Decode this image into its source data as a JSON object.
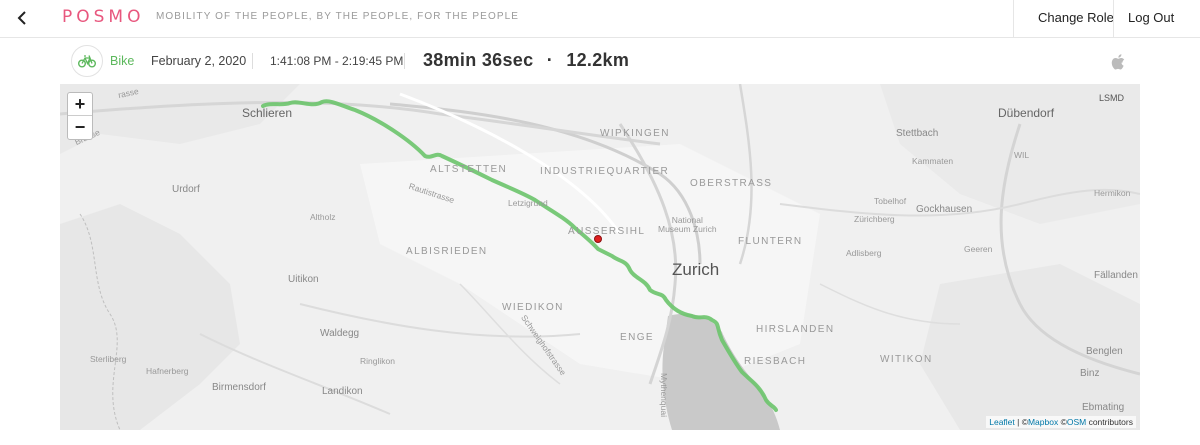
{
  "header": {
    "logo": "POSMO",
    "tagline": "MOBILITY OF THE PEOPLE, BY THE PEOPLE, FOR THE PEOPLE",
    "change_role": "Change Role",
    "log_out": "Log Out",
    "back_icon": "chevron-left-icon",
    "brand_color": "#e8577e"
  },
  "trip": {
    "mode_icon": "bicycle-icon",
    "mode": "Bike",
    "mode_color": "#5cb85c",
    "date": "February 2, 2020",
    "time_range": "1:41:08 PM - 2:19:45 PM",
    "duration": "38min 36sec",
    "separator": "·",
    "distance": "12.2km",
    "device_icon": "apple-icon"
  },
  "map": {
    "zoom_in": "+",
    "zoom_out": "−",
    "route_color": "#6cc46c",
    "marker_color": "#e02020",
    "attribution": {
      "leaflet": "Leaflet",
      "sep": " | ©",
      "mapbox": "Mapbox",
      "sep2": " ©",
      "osm": "OSM",
      "contributors": " contributors"
    },
    "labels": {
      "schlieren": "Schlieren",
      "dubendorf": "Dübendorf",
      "zurich": "Zurich",
      "wipkingen": "WIPKINGEN",
      "industriequartier": "INDUSTRIEQUARTIER",
      "altstetten": "ALTSTETTEN",
      "oberstrass": "OBERSTRASS",
      "aussersihl": "AUSSERSIHL",
      "fluntern": "FLUNTERN",
      "albisrieden": "ALBISRIEDEN",
      "wiedikon": "WIEDIKON",
      "enge": "ENGE",
      "hirslanden": "HIRSLANDEN",
      "riesbach": "RIESBACH",
      "witikon": "WITIKON",
      "urdorf": "Urdorf",
      "uitikon": "Uitikon",
      "waldegg": "Waldegg",
      "birmensdorf": "Birmensdorf",
      "landikon": "Landikon",
      "stettbach": "Stettbach",
      "gockhausen": "Gockhausen",
      "fallanden": "Fällanden",
      "benglen": "Benglen",
      "binz": "Binz",
      "ebmating": "Ebmating",
      "altholz": "Altholz",
      "letzigrund": "Letzigrund",
      "rautistrasse": "Rautistrasse",
      "schweighofstrasse": "Schweighofstrasse",
      "museum": "National\nMuseum Zurich",
      "ringlikon": "Ringlikon",
      "hafnerberg": "Hafnerberg",
      "sterliberg": "Sterliberg",
      "kammaten": "Kammaten",
      "wil": "WIL",
      "hermikon": "Hermikon",
      "tobelhof": "Tobelhof",
      "zurichberg": "Zürichberg",
      "adlisberg": "Adlisberg",
      "geeren": "Geeren",
      "lsmd": "LSMD",
      "mythenquai": "Mythenquai",
      "strasse_top": "rasse",
      "strasse_left": "Brasse"
    }
  }
}
